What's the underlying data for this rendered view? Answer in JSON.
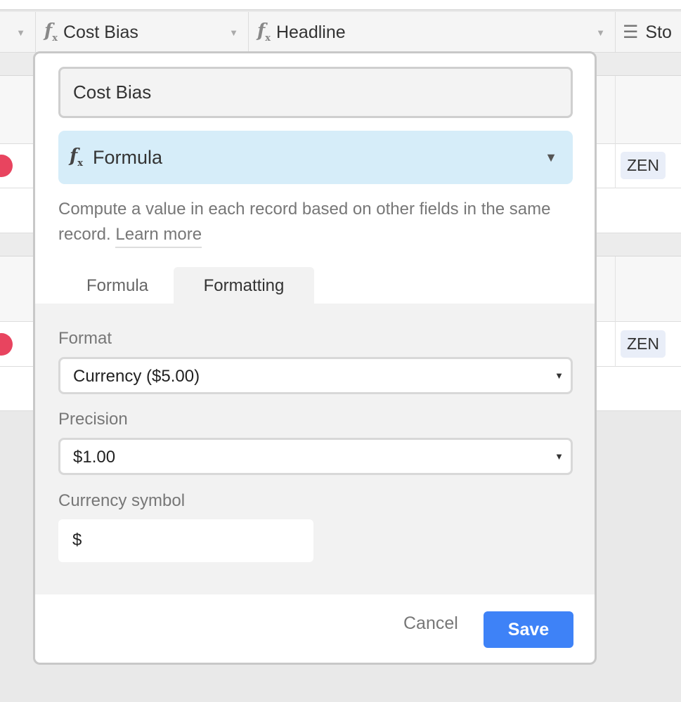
{
  "grid": {
    "columns": [
      {
        "label": "Cost Bias",
        "icon": "formula-icon"
      },
      {
        "label": "Headline",
        "icon": "formula-icon"
      },
      {
        "label": "Sto",
        "icon": "lookup-icon"
      }
    ],
    "tags": [
      "ZEN",
      "ZEN"
    ]
  },
  "dialog": {
    "field_name": "Cost Bias",
    "field_type": "Formula",
    "type_icon": "formula-icon",
    "description": "Compute a value in each record based on other fields in the same record.",
    "learn_more": "Learn more",
    "tabs": [
      "Formula",
      "Formatting"
    ],
    "active_tab": "Formatting",
    "format_label": "Format",
    "format_value": "Currency ($5.00)",
    "precision_label": "Precision",
    "precision_value": "$1.00",
    "currency_label": "Currency symbol",
    "currency_value": "$",
    "cancel": "Cancel",
    "save": "Save",
    "accent": "#3e82f7"
  }
}
